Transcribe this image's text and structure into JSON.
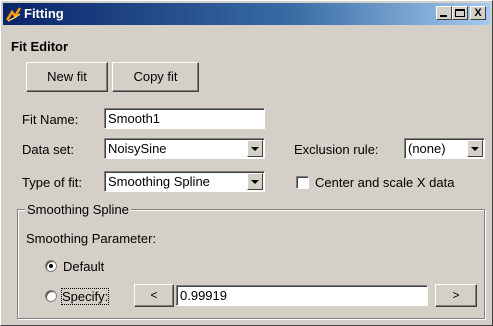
{
  "window": {
    "title": "Fitting",
    "controls": {
      "minimize": "_",
      "maximize": "□",
      "close": "X"
    }
  },
  "editor": {
    "heading": "Fit Editor",
    "new_fit_label": "New fit",
    "copy_fit_label": "Copy fit",
    "fit_name_label": "Fit Name:",
    "fit_name_value": "Smooth1",
    "data_set_label": "Data set:",
    "data_set_value": "NoisySine",
    "exclusion_label": "Exclusion rule:",
    "exclusion_value": "(none)",
    "type_label": "Type of fit:",
    "type_value": "Smoothing Spline",
    "center_scale_label": "Center and scale X data",
    "center_scale_checked": false
  },
  "smoothing": {
    "group_title": "Smoothing Spline",
    "param_label": "Smoothing Parameter:",
    "default_label": "Default",
    "specify_label": "Specify:",
    "selected": "default",
    "decrease_label": "<",
    "increase_label": ">",
    "value": "0.99919"
  },
  "icons": {
    "app": "fitting-app-icon"
  }
}
